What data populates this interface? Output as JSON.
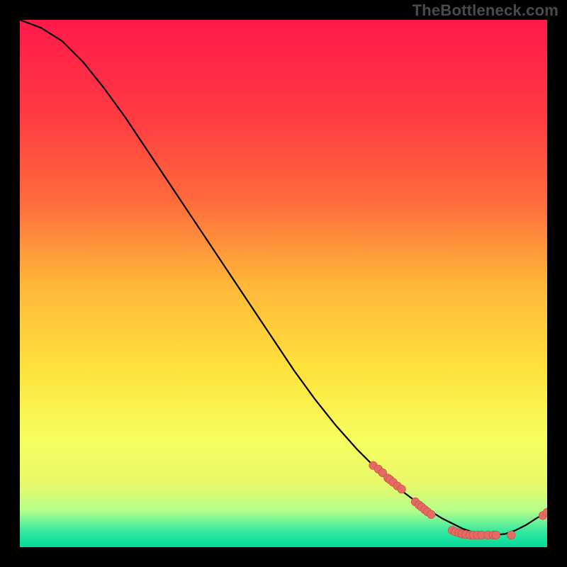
{
  "watermark": "TheBottleneck.com",
  "colors": {
    "background": "#000000",
    "grad_top": "#ff1a4a",
    "grad_mid1": "#ff6a3c",
    "grad_mid2": "#ffb63a",
    "grad_mid3": "#ffe23c",
    "grad_mid4": "#e8f86a",
    "grad_low1": "#b6ff8a",
    "grad_low2": "#36e8a0",
    "grad_bottom": "#00d99a",
    "curve": "#000000",
    "dot_fill": "#e46a62",
    "dot_stroke": "#c24a46"
  },
  "chart_data": {
    "type": "line",
    "title": "",
    "xlabel": "",
    "ylabel": "",
    "xlim": [
      0,
      100
    ],
    "ylim": [
      0,
      100
    ],
    "series": [
      {
        "name": "curve",
        "x": [
          0,
          4,
          8,
          12,
          16,
          20,
          24,
          28,
          32,
          36,
          40,
          44,
          48,
          52,
          56,
          60,
          64,
          68,
          72,
          76,
          80,
          82,
          84,
          86,
          88,
          90,
          92,
          94,
          96,
          98,
          100
        ],
        "y": [
          100,
          98.5,
          96,
          92,
          87,
          81.5,
          75.5,
          69.5,
          63.5,
          57.5,
          51.5,
          45.5,
          39.5,
          33.5,
          28,
          23,
          18.5,
          14.5,
          11,
          8,
          5.5,
          4.5,
          3.5,
          2.8,
          2.3,
          2.3,
          2.5,
          3.2,
          4.2,
          5.5,
          6.6
        ]
      }
    ],
    "points": [
      {
        "x": 67,
        "y": 15.5
      },
      {
        "x": 68,
        "y": 14.8
      },
      {
        "x": 68.8,
        "y": 14.1
      },
      {
        "x": 69.8,
        "y": 13.1
      },
      {
        "x": 70.2,
        "y": 12.8
      },
      {
        "x": 70.8,
        "y": 12.3
      },
      {
        "x": 71.6,
        "y": 11.6
      },
      {
        "x": 72.4,
        "y": 11.0
      },
      {
        "x": 75.0,
        "y": 8.6
      },
      {
        "x": 75.7,
        "y": 8.0
      },
      {
        "x": 76.2,
        "y": 7.6
      },
      {
        "x": 76.8,
        "y": 7.1
      },
      {
        "x": 77.3,
        "y": 6.7
      },
      {
        "x": 78.0,
        "y": 6.2
      },
      {
        "x": 82.0,
        "y": 3.2
      },
      {
        "x": 82.6,
        "y": 2.9
      },
      {
        "x": 83.3,
        "y": 2.7
      },
      {
        "x": 83.9,
        "y": 2.5
      },
      {
        "x": 84.6,
        "y": 2.4
      },
      {
        "x": 85.4,
        "y": 2.3
      },
      {
        "x": 86.0,
        "y": 2.3
      },
      {
        "x": 86.8,
        "y": 2.3
      },
      {
        "x": 87.6,
        "y": 2.3
      },
      {
        "x": 88.8,
        "y": 2.3
      },
      {
        "x": 89.8,
        "y": 2.3
      },
      {
        "x": 90.3,
        "y": 2.3
      },
      {
        "x": 93.2,
        "y": 2.3
      },
      {
        "x": 99.2,
        "y": 6.0
      },
      {
        "x": 100,
        "y": 6.6
      }
    ]
  }
}
